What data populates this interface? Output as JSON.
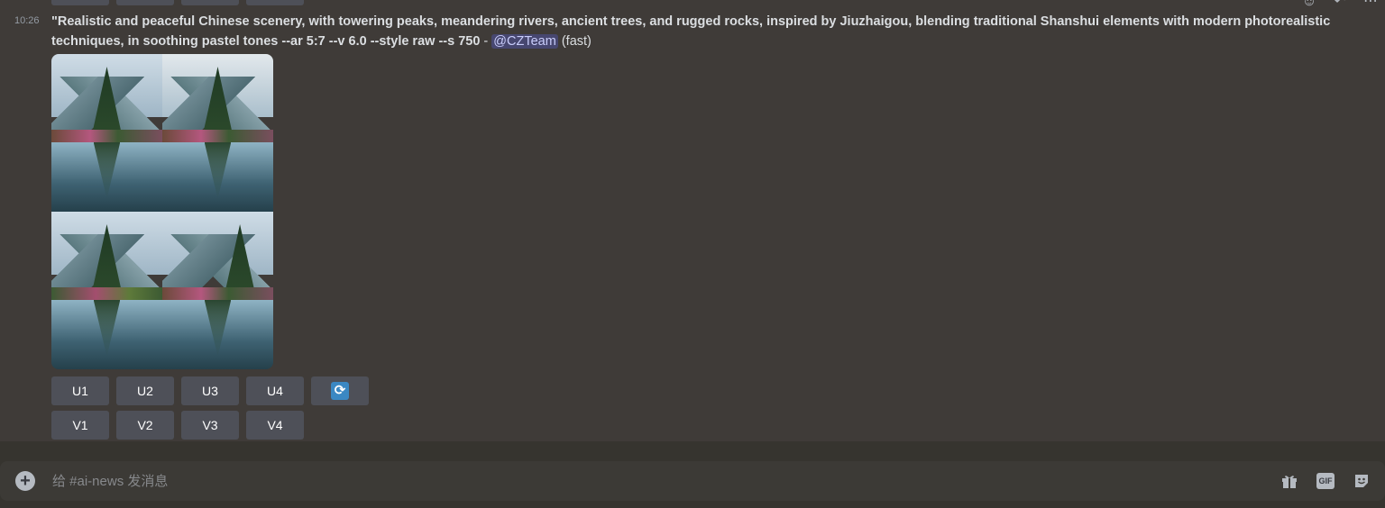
{
  "message": {
    "timestamp": "10:26",
    "prompt_text": "\"Realistic and peaceful Chinese scenery, with towering peaks, meandering rivers, ancient trees, and rugged rocks, inspired by Jiuzhaigou, blending traditional Shanshui elements with modern photorealistic techniques, in soothing pastel tones --ar 5:7 --v 6.0 --style raw --s 750",
    "separator": " - ",
    "mention": "@CZTeam",
    "speed": " (fast)"
  },
  "image_grid": {
    "alt": "4 generated landscape images"
  },
  "upscale_buttons": [
    "U1",
    "U2",
    "U3",
    "U4"
  ],
  "variation_buttons": [
    "V1",
    "V2",
    "V3",
    "V4"
  ],
  "reroll_icon": "refresh-icon",
  "composer": {
    "placeholder": "给 #ai-news 发消息"
  },
  "composer_icons": [
    "gift-icon",
    "gif-icon",
    "sticker-icon"
  ],
  "gif_label": "GIF",
  "colors": {
    "background": "#3f3b38",
    "button": "#4e5058",
    "mention_bg": "#5865f2",
    "reroll_blue": "#3b88c3"
  }
}
